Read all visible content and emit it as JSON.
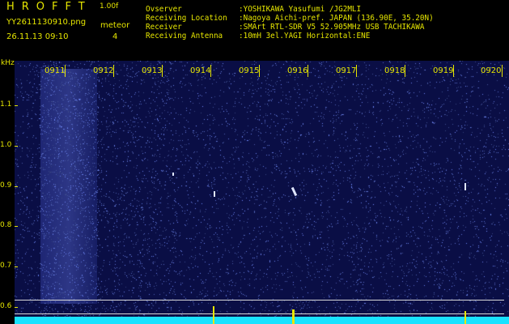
{
  "header": {
    "app_title": "HROFFT",
    "version": "1.00f",
    "filename": "YY2611130910.png",
    "timestamp": "26.11.13 09:10",
    "meteor_label": "meteor",
    "meteor_count": "4",
    "info_rows": [
      {
        "key": "Ovserver",
        "value": ":YOSHIKAWA Yasufumi /JG2MLI"
      },
      {
        "key": "Receiving Location",
        "value": ":Nagoya Aichi-pref. JAPAN (136.90E, 35.20N)"
      },
      {
        "key": "Receiver",
        "value": ":SMArt RTL-SDR V5 52.905MHz USB TACHIKAWA"
      },
      {
        "key": "Receiving Antenna",
        "value": ":10mH 3el.YAGI Horizontal:ENE"
      }
    ]
  },
  "spectrogram": {
    "y_unit": "kHz",
    "y_ticks": [
      "1.1",
      "1.0",
      "0.9",
      "0.8",
      "0.7",
      "0.6"
    ],
    "x_ticks": [
      "0911",
      "0912",
      "0913",
      "0914",
      "0915",
      "0916",
      "0917",
      "0918",
      "0919",
      "0920"
    ],
    "colors": {
      "background": "#0a0e45",
      "noise": "#5a6cff",
      "labels": "#e6e600",
      "baseline": "#19e2ff"
    }
  }
}
